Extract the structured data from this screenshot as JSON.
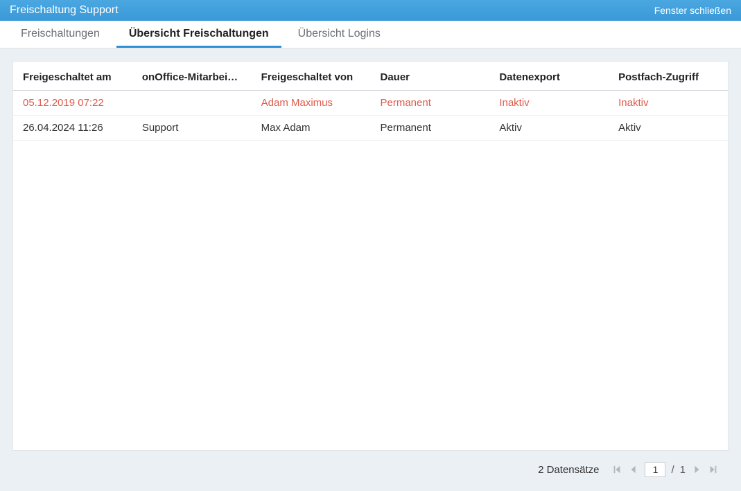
{
  "titlebar": {
    "title": "Freischaltung Support",
    "close": "Fenster schließen"
  },
  "tabs": [
    {
      "label": "Freischaltungen",
      "active": false
    },
    {
      "label": "Übersicht Freischaltungen",
      "active": true
    },
    {
      "label": "Übersicht Logins",
      "active": false
    }
  ],
  "table": {
    "headers": [
      "Freigeschaltet am",
      "onOffice-Mitarbei…",
      "Freigeschaltet von",
      "Dauer",
      "Datenexport",
      "Postfach-Zugriff"
    ],
    "rows": [
      {
        "red": true,
        "cells": [
          "05.12.2019 07:22",
          "",
          "Adam Maximus",
          "Permanent",
          "Inaktiv",
          "Inaktiv"
        ]
      },
      {
        "red": false,
        "cells": [
          "26.04.2024 11:26",
          "Support",
          "Max Adam",
          "Permanent",
          "Aktiv",
          "Aktiv"
        ]
      }
    ]
  },
  "pager": {
    "count_label": "2 Datensätze",
    "page": "1",
    "total": "1",
    "sep": "/"
  }
}
